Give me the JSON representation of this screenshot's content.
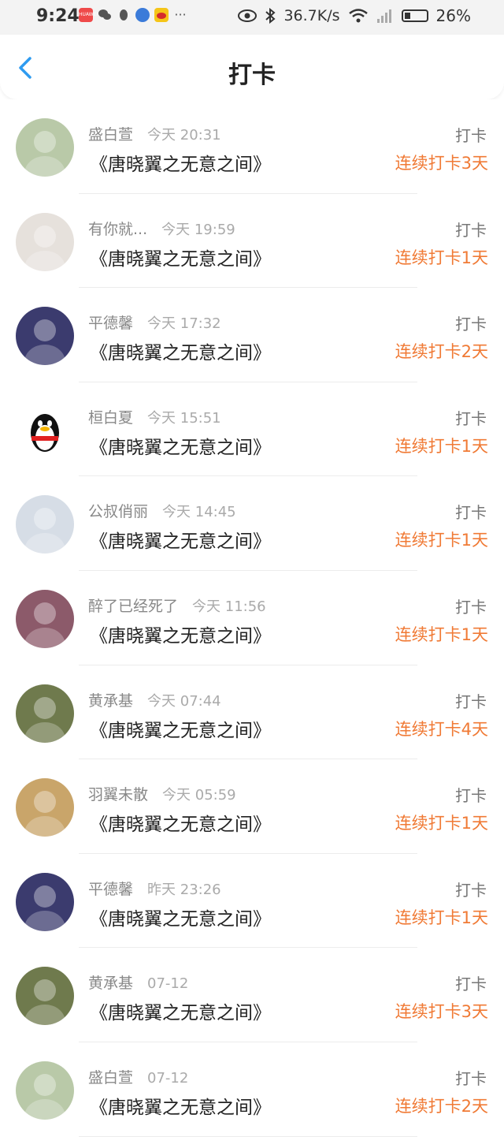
{
  "status_bar": {
    "time": "9:24",
    "network_speed": "36.7K/s",
    "battery": "26%",
    "notification_badge": "HUAWEI"
  },
  "nav": {
    "title": "打卡"
  },
  "rows": [
    {
      "name": "盛白萱",
      "time": "今天 20:31",
      "book": "《唐晓翼之无意之间》",
      "tag": "打卡",
      "streak": "连续打卡3天",
      "avatar_color": "#b9c9a8"
    },
    {
      "name": "有你就...",
      "time": "今天 19:59",
      "book": "《唐晓翼之无意之间》",
      "tag": "打卡",
      "streak": "连续打卡1天",
      "avatar_color": "#e6e1dc"
    },
    {
      "name": "平德馨",
      "time": "今天 17:32",
      "book": "《唐晓翼之无意之间》",
      "tag": "打卡",
      "streak": "连续打卡2天",
      "avatar_color": "#3b3b6e"
    },
    {
      "name": "桓白夏",
      "time": "今天 15:51",
      "book": "《唐晓翼之无意之间》",
      "tag": "打卡",
      "streak": "连续打卡1天",
      "avatar_color": "#ffffff"
    },
    {
      "name": "公叔俏丽",
      "time": "今天 14:45",
      "book": "《唐晓翼之无意之间》",
      "tag": "打卡",
      "streak": "连续打卡1天",
      "avatar_color": "#d6dde6"
    },
    {
      "name": "醉了已经死了",
      "time": "今天 11:56",
      "book": "《唐晓翼之无意之间》",
      "tag": "打卡",
      "streak": "连续打卡1天",
      "avatar_color": "#8c5a6a"
    },
    {
      "name": "黄承基",
      "time": "今天 07:44",
      "book": "《唐晓翼之无意之间》",
      "tag": "打卡",
      "streak": "连续打卡4天",
      "avatar_color": "#6f7a4d"
    },
    {
      "name": "羽翼未散",
      "time": "今天 05:59",
      "book": "《唐晓翼之无意之间》",
      "tag": "打卡",
      "streak": "连续打卡1天",
      "avatar_color": "#c9a56a"
    },
    {
      "name": "平德馨",
      "time": "昨天 23:26",
      "book": "《唐晓翼之无意之间》",
      "tag": "打卡",
      "streak": "连续打卡1天",
      "avatar_color": "#3b3b6e"
    },
    {
      "name": "黄承基",
      "time": "07-12",
      "book": "《唐晓翼之无意之间》",
      "tag": "打卡",
      "streak": "连续打卡3天",
      "avatar_color": "#6f7a4d"
    },
    {
      "name": "盛白萱",
      "time": "07-12",
      "book": "《唐晓翼之无意之间》",
      "tag": "打卡",
      "streak": "连续打卡2天",
      "avatar_color": "#b9c9a8"
    }
  ]
}
